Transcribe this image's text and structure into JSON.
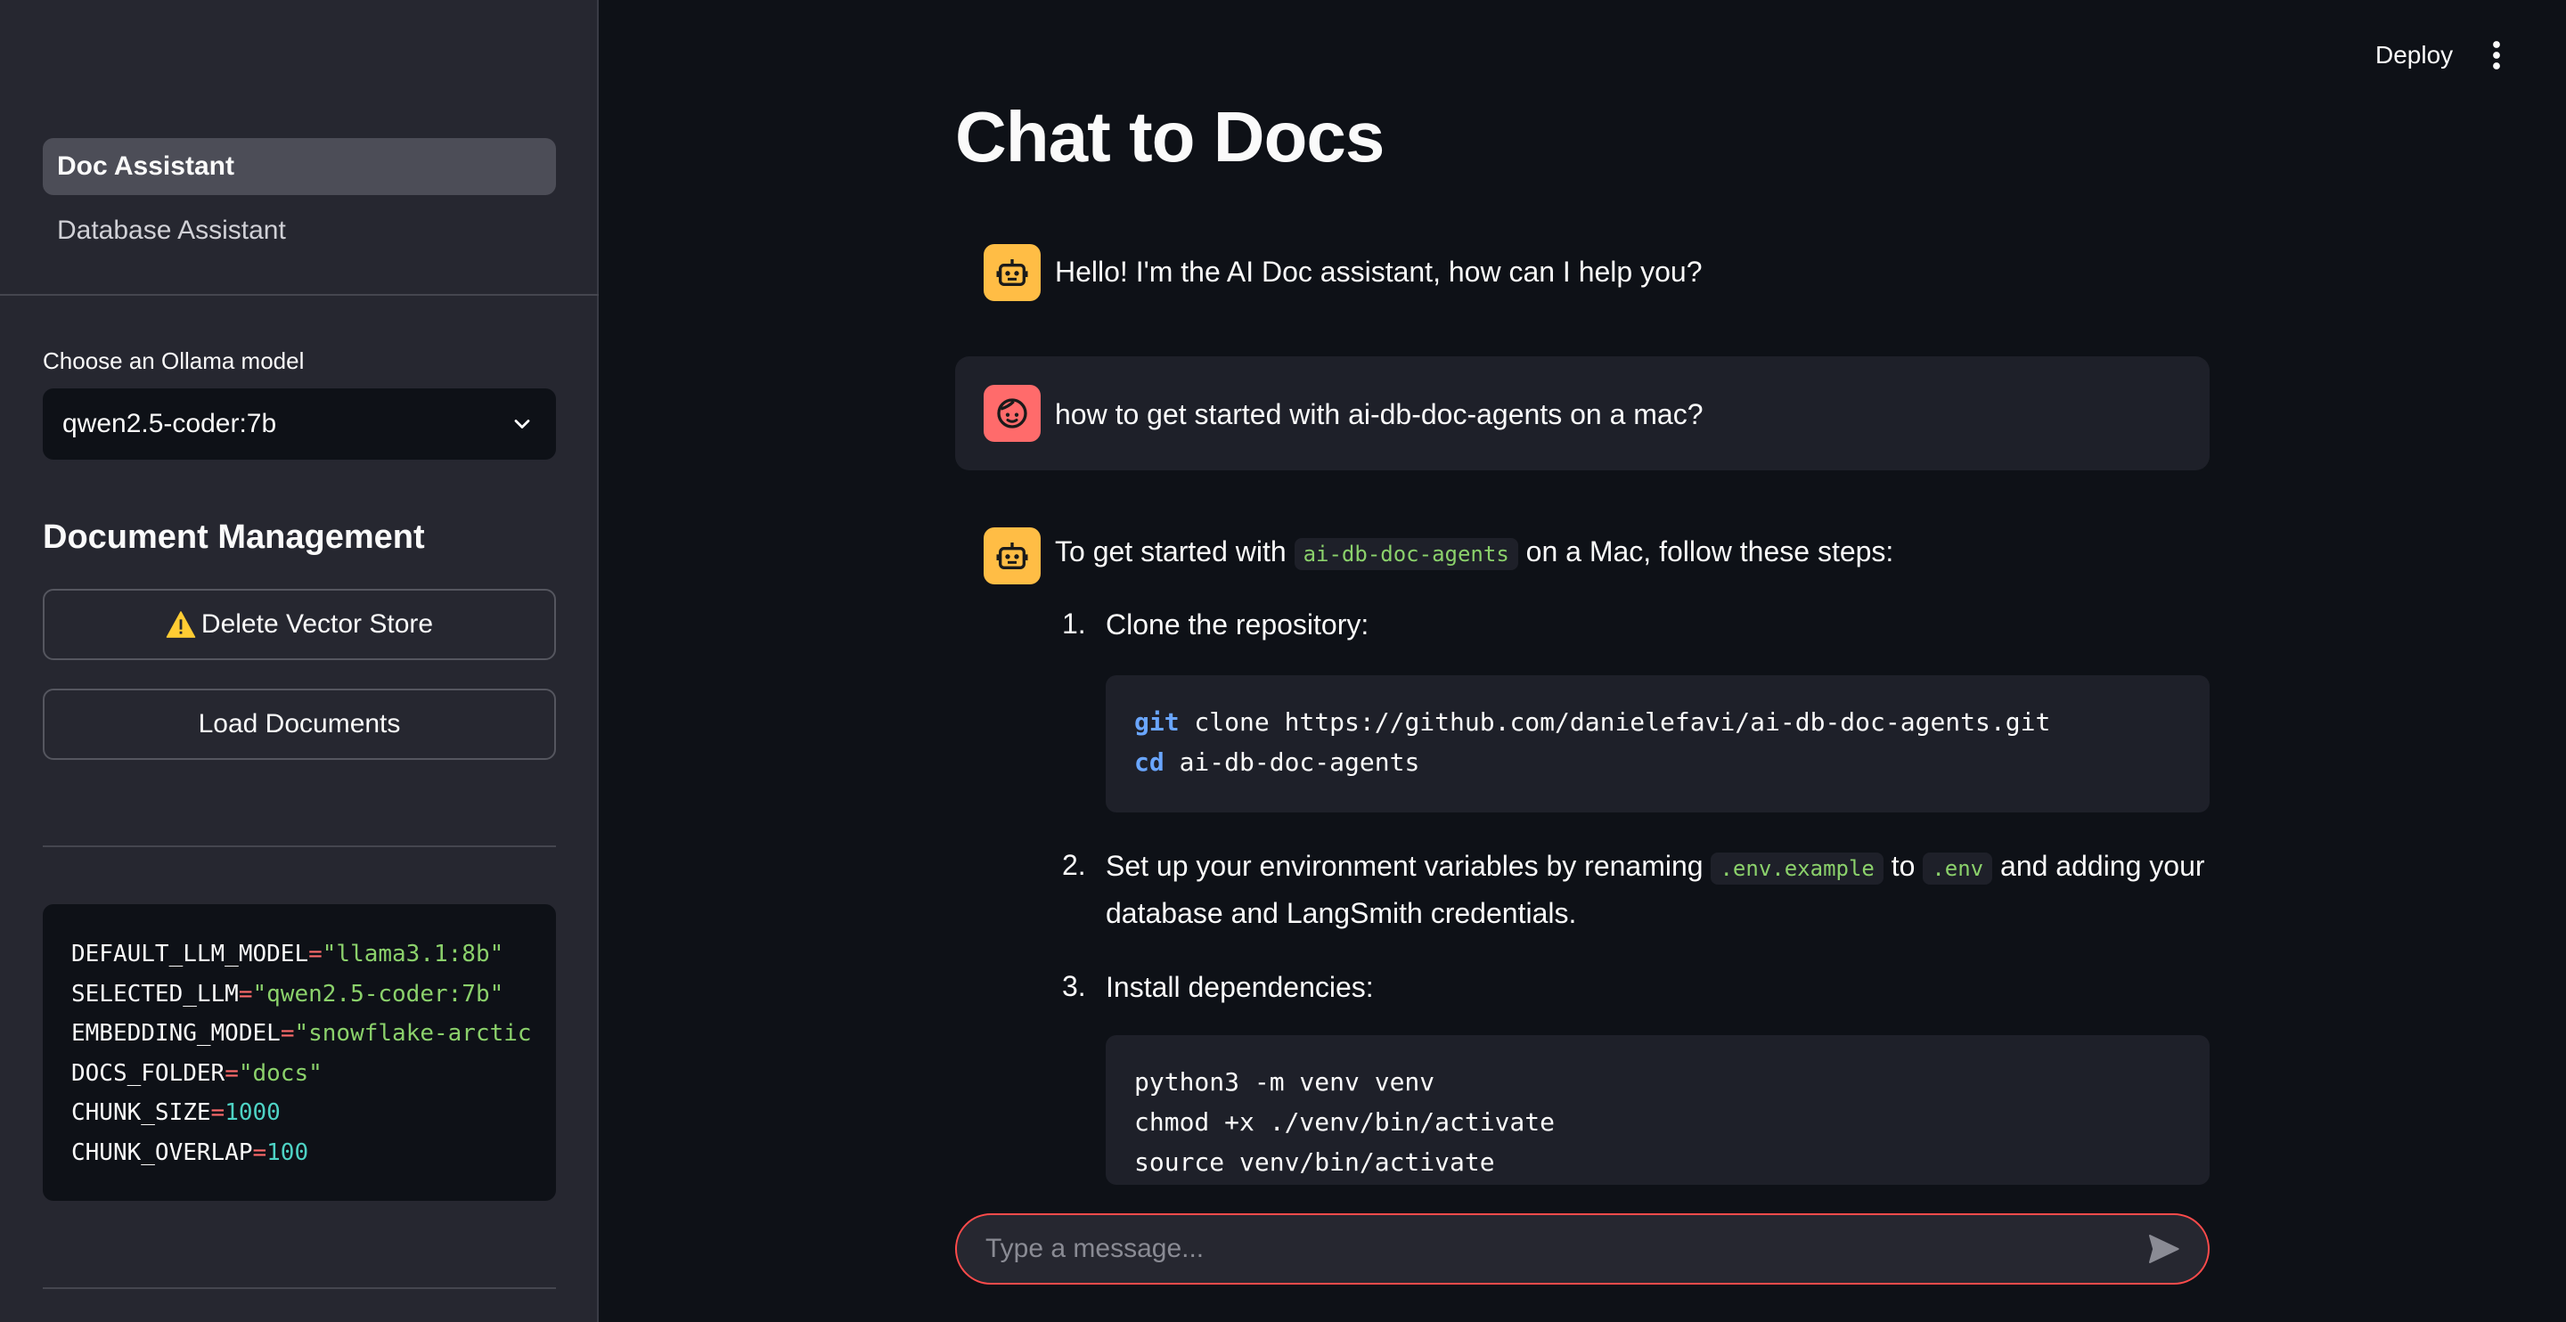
{
  "sidebar": {
    "nav": [
      {
        "label": "Doc Assistant",
        "active": true
      },
      {
        "label": "Database Assistant",
        "active": false
      }
    ],
    "model_label": "Choose an Ollama model",
    "model_value": "qwen2.5-coder:7b",
    "section_title": "Document Management",
    "delete_button": "Delete Vector Store",
    "load_button": "Load Documents",
    "env": [
      {
        "key": "DEFAULT_LLM_MODEL",
        "value": "\"llama3.1:8b\"",
        "kind": "str"
      },
      {
        "key": "SELECTED_LLM",
        "value": "\"qwen2.5-coder:7b\"",
        "kind": "str"
      },
      {
        "key": "EMBEDDING_MODEL",
        "value": "\"snowflake-arctic",
        "kind": "str"
      },
      {
        "key": "DOCS_FOLDER",
        "value": "\"docs\"",
        "kind": "str"
      },
      {
        "key": "CHUNK_SIZE",
        "value": "1000",
        "kind": "num"
      },
      {
        "key": "CHUNK_OVERLAP",
        "value": "100",
        "kind": "num"
      }
    ]
  },
  "header": {
    "deploy_label": "Deploy",
    "menu_icon": "vertical-ellipsis-icon"
  },
  "main": {
    "title": "Chat to Docs",
    "greeting": "Hello! I'm the AI Doc assistant, how can I help you?",
    "user_question": "how to get started with ai-db-doc-agents on a mac?",
    "answer": {
      "intro_before": "To get started with",
      "intro_code": "ai-db-doc-agents",
      "intro_after": "on a Mac, follow these steps:",
      "step1_num": "1.",
      "step1": "Clone the repository:",
      "step1_code_kw1": "git",
      "step1_code_rest1": " clone https://github.com/danielefavi/ai-db-doc-agents.git",
      "step1_code_kw2": "cd",
      "step1_code_rest2": " ai-db-doc-agents",
      "step2_num": "2.",
      "step2_a": "Set up your environment variables by renaming",
      "step2_code1": ".env.example",
      "step2_b": "to",
      "step2_code2": ".env",
      "step2_c": "and adding your",
      "step2_line2": "database and LangSmith credentials.",
      "step3_num": "3.",
      "step3": "Install dependencies:",
      "step3_code": [
        "python3 -m venv venv",
        "chmod +x ./venv/bin/activate",
        "source venv/bin/activate"
      ]
    },
    "chat_placeholder": "Type a message..."
  },
  "colors": {
    "accent": "#ff4b4b",
    "bot_avatar": "#ffbd45",
    "user_avatar": "#ff6b6b"
  }
}
